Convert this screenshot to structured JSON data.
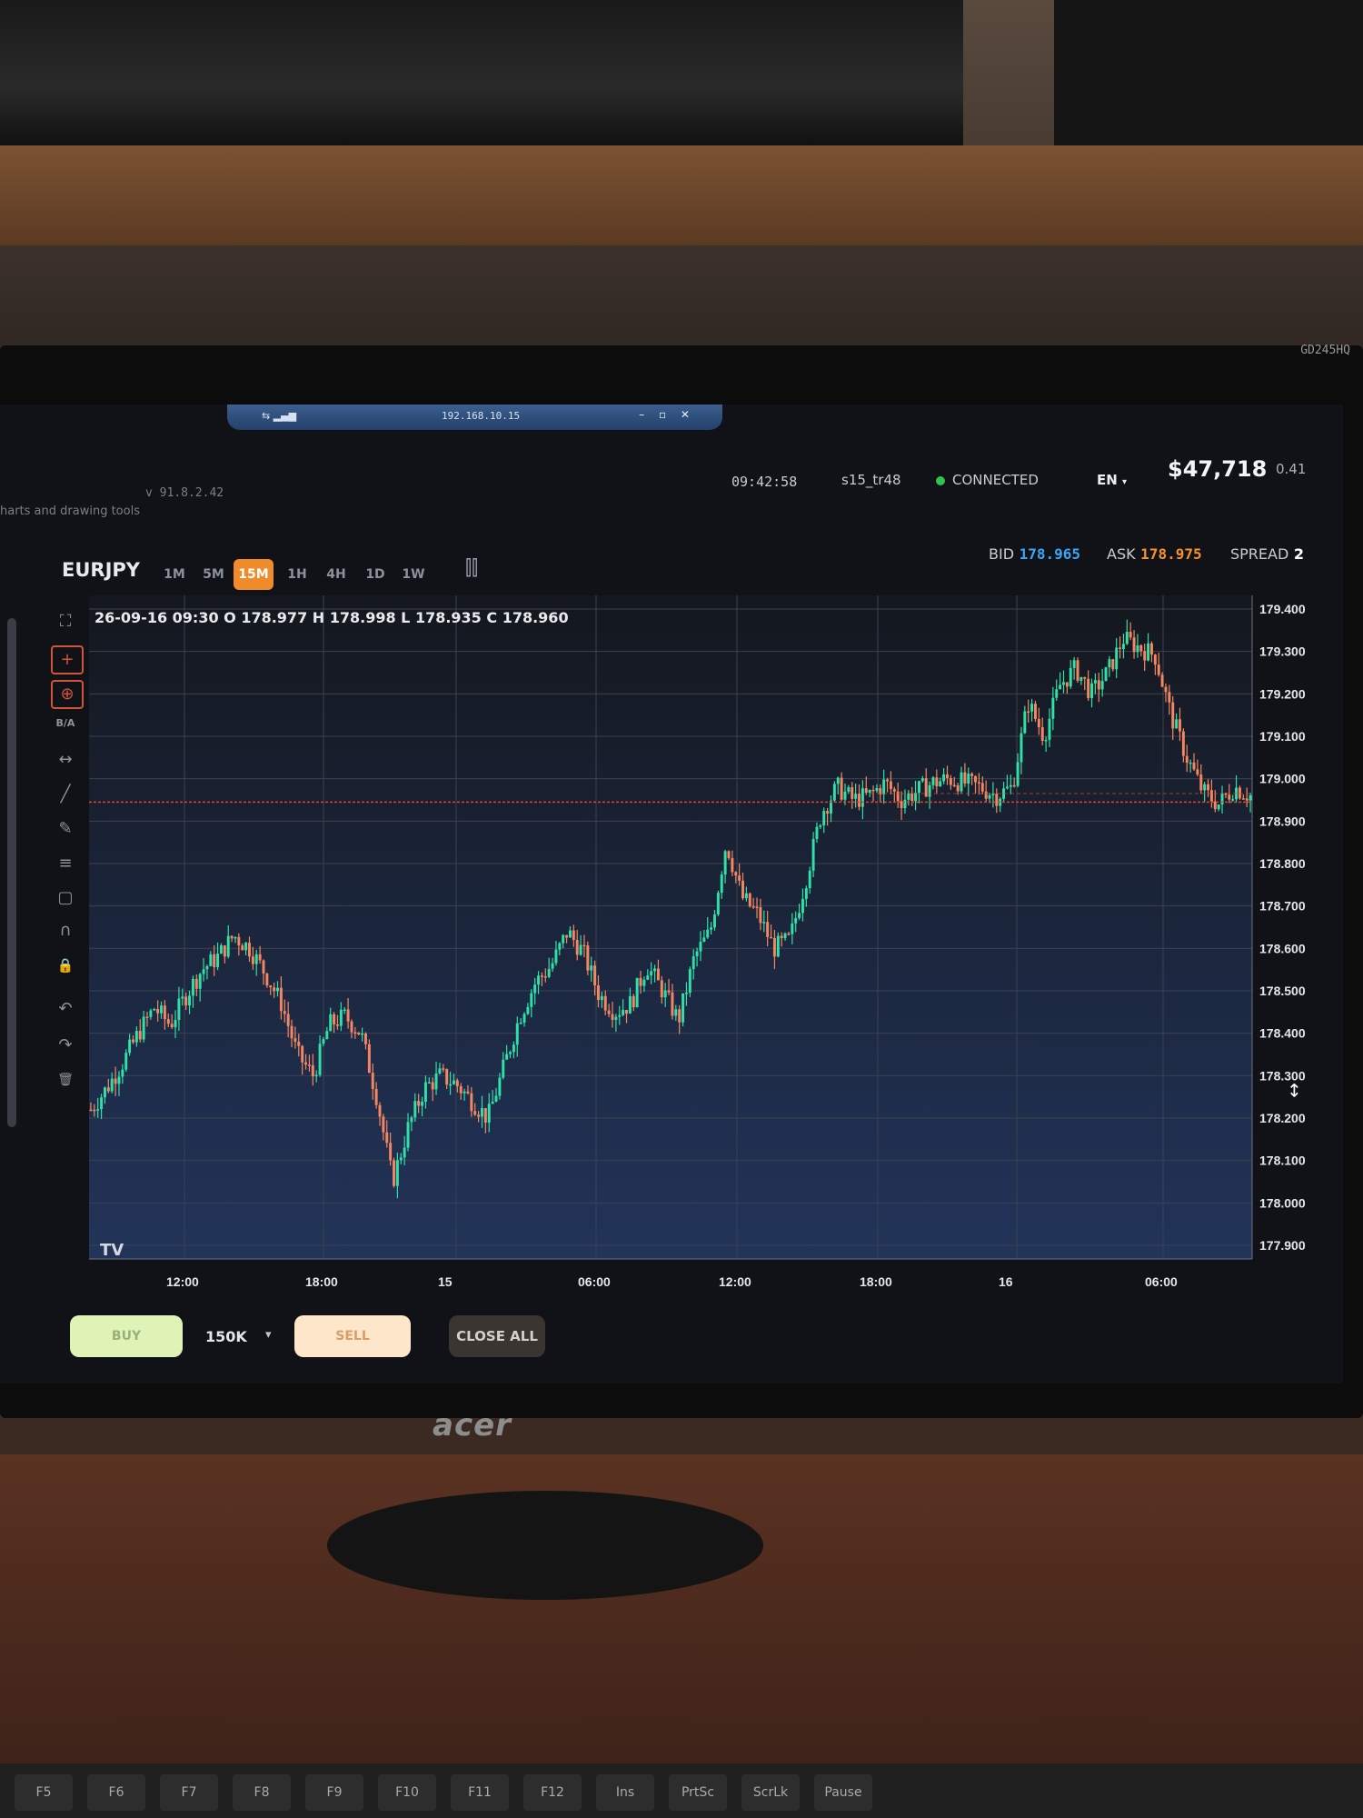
{
  "remote": {
    "signal_label": "⇆ ▂▄▆",
    "ip": "192.168.10.15",
    "controls": "– ▫ ✕"
  },
  "app": {
    "version": "v 91.8.2.42",
    "subtitle": "harts and drawing tools"
  },
  "status": {
    "time": "09:42:58",
    "account": "s15_tr48",
    "connection": "CONNECTED",
    "language": "EN",
    "language_arrow": "▾",
    "balance": "$47,718",
    "extra": "0.41"
  },
  "instrument": {
    "symbol": "EURJPY",
    "timeframes": [
      "1M",
      "5M",
      "15M",
      "1H",
      "4H",
      "1D",
      "1W"
    ],
    "active_timeframe": "15M"
  },
  "quote": {
    "bid_label": "BID",
    "bid": "178.965",
    "ask_label": "ASK",
    "ask": "178.975",
    "spread_label": "SPREAD",
    "spread": "2"
  },
  "ohlc_label": "26-09-16 09:30 O 178.977 H 178.998 L 178.935 C 178.960",
  "toolbar": {
    "fullscreen_icon": "⛶",
    "crosshair_icon": "+",
    "cross2_icon": "⊕",
    "ba_label": "B/A",
    "measure_icon": "↔",
    "trendline_icon": "╱",
    "pencil_icon": "✎",
    "fib_icon": "≡",
    "rect_icon": "▢",
    "magnet_icon": "∩",
    "lock_icon": "🔒",
    "undo_icon": "↶",
    "redo_icon": "↷",
    "trash_icon": "🗑"
  },
  "colors": {
    "up": "#2fe0a8",
    "down": "#f48762",
    "grid": "#3a4250",
    "hline": "#e5412e",
    "bg_top": "#14171d",
    "bg_bottom": "#22345a"
  },
  "trade": {
    "buy": "BUY",
    "quantity": "150K",
    "quantity_arrow": "▾",
    "sell": "SELL",
    "close_all": "CLOSE ALL"
  },
  "tv_logo": "TV",
  "scroll_icon": "↕",
  "monitor": {
    "model": "GD245HQ",
    "brand": "acer"
  },
  "keyboard": [
    "F5",
    "F6",
    "F7",
    "F8",
    "F9",
    "F10",
    "F11",
    "F12",
    "Ins",
    "PrtSc",
    "ScrLk",
    "Pause"
  ],
  "chart_data": {
    "type": "candlestick",
    "y_ticks": [
      "179.400",
      "179.300",
      "179.200",
      "179.100",
      "179.000",
      "178.900",
      "178.800",
      "178.700",
      "178.600",
      "178.500",
      "178.400",
      "178.300",
      "178.200",
      "178.100",
      "178.000",
      "177.900"
    ],
    "ylim": [
      177.9,
      179.4
    ],
    "x_ticks": [
      "12:00",
      "18:00",
      "15",
      "06:00",
      "12:00",
      "18:00",
      "16",
      "06:00"
    ],
    "horizontal_line": 178.945,
    "dashed_line": 178.965,
    "close_path": [
      178.22,
      178.27,
      178.33,
      178.4,
      178.46,
      178.42,
      178.49,
      178.55,
      178.58,
      178.63,
      178.6,
      178.54,
      178.47,
      178.35,
      178.3,
      178.42,
      178.44,
      178.4,
      178.25,
      178.05,
      178.18,
      178.27,
      178.3,
      178.28,
      178.24,
      178.2,
      178.32,
      178.44,
      178.52,
      178.56,
      178.64,
      178.59,
      178.49,
      178.45,
      178.47,
      178.56,
      178.5,
      178.43,
      178.58,
      178.64,
      178.85,
      178.72,
      178.68,
      178.6,
      178.62,
      178.76,
      178.92,
      178.98,
      178.95,
      178.96,
      178.99,
      178.95,
      178.97,
      178.99,
      179.0,
      178.99,
      178.98,
      178.96,
      178.98,
      179.18,
      179.1,
      179.22,
      179.26,
      179.2,
      179.25,
      179.33,
      179.31,
      179.29,
      179.15,
      179.05,
      178.97,
      178.94,
      178.98,
      178.96
    ]
  }
}
